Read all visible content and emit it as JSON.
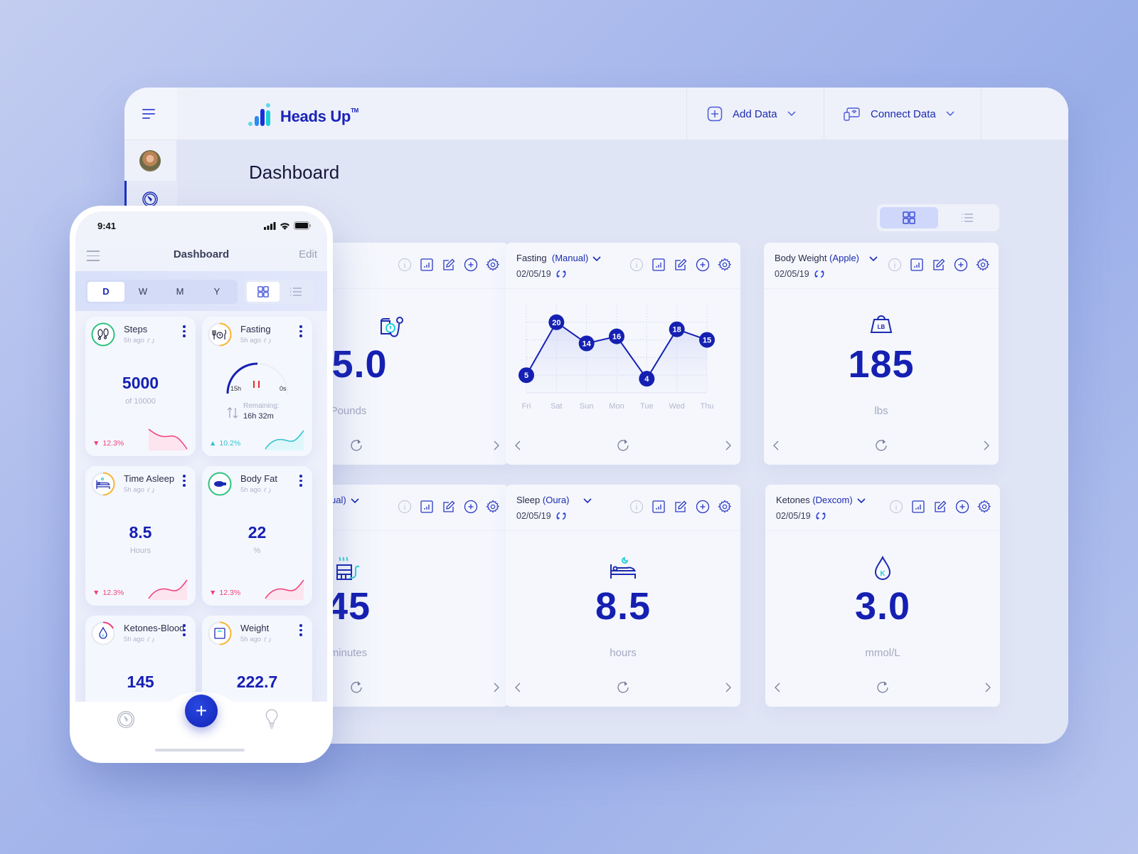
{
  "app": {
    "name": "Heads Up",
    "trademark": "TM",
    "page_title": "Dashboard",
    "accent": "#1b2bb0",
    "accent_dark": "#1520b2",
    "teal": "#2ed0d8"
  },
  "topbar": {
    "add_data_label": "Add Data",
    "connect_data_label": "Connect Data"
  },
  "sidebar": {
    "menu_icon": "menu-icon",
    "avatar": "user-avatar",
    "items": [
      {
        "icon": "speedometer-icon",
        "active": true
      }
    ]
  },
  "view_toggle": {
    "options": [
      "grid",
      "list"
    ],
    "selected": "grid"
  },
  "cards": [
    {
      "id": "blood-pressure",
      "title": "",
      "source": "",
      "date": "",
      "icon": "blood-pressure-icon",
      "value": "25.0",
      "unit": "Pounds"
    },
    {
      "id": "fasting",
      "title": "Fasting",
      "source": "(Manual)",
      "date": "02/05/19",
      "type": "chart"
    },
    {
      "id": "body-weight",
      "title": "Body Weight",
      "source": "(Apple)",
      "date": "02/05/19",
      "icon": "weight-lb-icon",
      "value": "185",
      "unit": "lbs"
    },
    {
      "id": "sauna",
      "title": "",
      "source": "ual)",
      "date": "",
      "icon": "sauna-icon",
      "value": "45",
      "unit": "minutes"
    },
    {
      "id": "sleep",
      "title": "Sleep",
      "source": "(Oura)",
      "date": "02/05/19",
      "icon": "bed-icon",
      "value": "8.5",
      "unit": "hours"
    },
    {
      "id": "ketones",
      "title": "Ketones",
      "source": "(Dexcom)",
      "date": "02/05/19",
      "icon": "ketone-drop-icon",
      "value": "3.0",
      "unit": "mmol/L"
    }
  ],
  "chart_data": {
    "type": "line",
    "title": "Fasting (Manual)",
    "categories": [
      "Fri",
      "Sat",
      "Sun",
      "Mon",
      "Tue",
      "Wed",
      "Thu"
    ],
    "values": [
      5,
      20,
      14,
      16,
      4,
      18,
      15
    ],
    "xlabel": "",
    "ylabel": "",
    "ylim": [
      0,
      25
    ],
    "grid": true,
    "data_labels": true
  },
  "phone": {
    "time": "9:41",
    "title": "Dashboard",
    "edit_label": "Edit",
    "periods": [
      "D",
      "W",
      "M",
      "Y"
    ],
    "selected_period": "D",
    "tiles": [
      {
        "name": "Steps",
        "ago": "5h ago",
        "value": "5000",
        "sub": "of 10000",
        "trend": "12.3%",
        "trend_dir": "down",
        "ring_color": "#2ec27e",
        "ring_progress": 1.0,
        "icon": "footprints-icon"
      },
      {
        "name": "Fasting",
        "ago": "5h ago",
        "gauge_left": "15h",
        "gauge_right": "0s",
        "remaining_label": "Remaining:",
        "remaining_value": "16h 32m",
        "trend": "10.2%",
        "trend_dir": "up",
        "ring_color": "#f5b731",
        "ring_progress": 0.5,
        "gauge_progress": 0.45,
        "icon": "fasting-clock-icon"
      },
      {
        "name": "Time Asleep",
        "ago": "5h ago",
        "value": "8.5",
        "sub": "Hours",
        "trend": "12.3%",
        "trend_dir": "down",
        "ring_color": "#f5b731",
        "ring_progress": 0.5,
        "icon": "bed-icon"
      },
      {
        "name": "Body Fat",
        "ago": "5h ago",
        "value": "22",
        "sub": "%",
        "trend": "12.3%",
        "trend_dir": "down",
        "ring_color": "#2ec27e",
        "ring_progress": 1.0,
        "icon": "body-fat-icon"
      },
      {
        "name": "Ketones-Blood",
        "ago": "5h ago",
        "value": "145",
        "ring_color": "#f0407a",
        "ring_progress": 0.2,
        "icon": "ketone-drop-icon"
      },
      {
        "name": "Weight",
        "ago": "5h ago",
        "value": "222.7",
        "ring_color": "#f5b731",
        "ring_progress": 0.5,
        "icon": "scale-icon"
      }
    ],
    "fab_label": "+"
  }
}
